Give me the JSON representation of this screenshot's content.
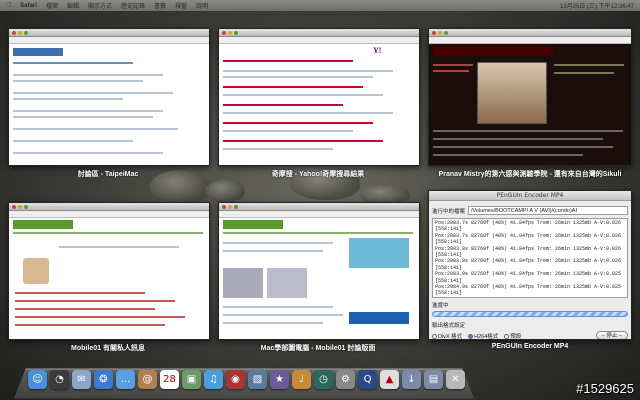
{
  "menubar": {
    "apple": "",
    "app": "Safari",
    "items": [
      "檔案",
      "編輯",
      "顯示方式",
      "歷史記錄",
      "書籤",
      "視窗",
      "說明"
    ],
    "clock": "13月25日 (三) 下午12:36:47"
  },
  "windows": [
    {
      "caption": "討論區 - TaipeiMac"
    },
    {
      "caption": "奇摩搜 - Yahoo!奇摩搜尋結果"
    },
    {
      "caption": "Pranav Mistry的第六感與測驗學院 - 還有來自台灣的Sikuli"
    },
    {
      "caption": "Mobile01 有關私人訊息"
    },
    {
      "caption": "Mac學部圖電腦 - Mobile01 討論版面"
    },
    {
      "caption": "PEnGUIn Encoder MP4"
    }
  ],
  "encoder": {
    "title": "PEnGUIn Encoder MP4",
    "file_label": "進行中的檔案",
    "path": "/Volumes/BOOTCAMP/ A V (AVI)/(condo)AI",
    "log": [
      "Pos:2083.7s 82769f (48%) 41.84fps Trem: 26min 1325mb A-V:0.026",
      "[558:141]",
      "Pos:2083.7s 82769f (48%) 41.84fps Trem: 26min 1325mb A-V:0.026",
      "[558:141]",
      "Pos:2083.8s 82769f (48%) 41.84fps Trem: 26min 1325mb A-V:0.026",
      "[558:141]",
      "Pos:2083.8s 82769f (48%) 41.84fps Trem: 26min 1325mb A-V:0.026",
      "[558:141]",
      "Pos:2083.9s 82769f (48%) 41.84fps Trem: 26min 1325mb A-V:0.025",
      "[558:141]",
      "Pos:2084.0s 82769f (48%) 41.84fps Trem: 26min 1325mb A-V:0.025",
      "[558:141]"
    ],
    "progress_label": "進度中",
    "progress": 0.48,
    "options_label": "輸出格式設定",
    "option_divx": "DivX 格式",
    "option_h264": "H264格式",
    "option_default": "預設",
    "stop_button": "– 停止 –"
  },
  "dock": {
    "icons": [
      {
        "name": "finder-icon",
        "color": "#4a8fd8",
        "glyph": "☺"
      },
      {
        "name": "dashboard-icon",
        "color": "#3b3b3b",
        "glyph": "◔"
      },
      {
        "name": "mail-icon",
        "color": "#8aa6c8",
        "glyph": "✉"
      },
      {
        "name": "safari-icon",
        "color": "#3a7ad0",
        "glyph": "❂"
      },
      {
        "name": "ichat-icon",
        "color": "#5aa0e0",
        "glyph": "…"
      },
      {
        "name": "address-book-icon",
        "color": "#b08050",
        "glyph": "@"
      },
      {
        "name": "ical-icon",
        "color": "#ffffff",
        "glyph": "28"
      },
      {
        "name": "preview-icon",
        "color": "#6c9a6a",
        "glyph": "▣"
      },
      {
        "name": "itunes-icon",
        "color": "#4aa0d8",
        "glyph": "♫"
      },
      {
        "name": "photo-booth-icon",
        "color": "#a33",
        "glyph": "◉"
      },
      {
        "name": "iphoto-icon",
        "color": "#5a7a9a",
        "glyph": "▧"
      },
      {
        "name": "imovie-icon",
        "color": "#6a5a9a",
        "glyph": "★"
      },
      {
        "name": "garageband-icon",
        "color": "#c8893a",
        "glyph": "♩"
      },
      {
        "name": "time-machine-icon",
        "color": "#2a6a5a",
        "glyph": "◷"
      },
      {
        "name": "system-preferences-icon",
        "color": "#888888",
        "glyph": "⚙"
      },
      {
        "name": "quicktime-icon",
        "color": "#2a4a8a",
        "glyph": "Q"
      },
      {
        "name": "penguin-icon",
        "color": "#dddddd",
        "glyph": "▲"
      },
      {
        "name": "downloads-icon",
        "color": "#7a8aa8",
        "glyph": "↓"
      },
      {
        "name": "documents-icon",
        "color": "#7a8aa8",
        "glyph": "▤"
      },
      {
        "name": "trash-icon",
        "color": "#b8b8b8",
        "glyph": "✕"
      }
    ]
  },
  "watermark": "#1529625"
}
